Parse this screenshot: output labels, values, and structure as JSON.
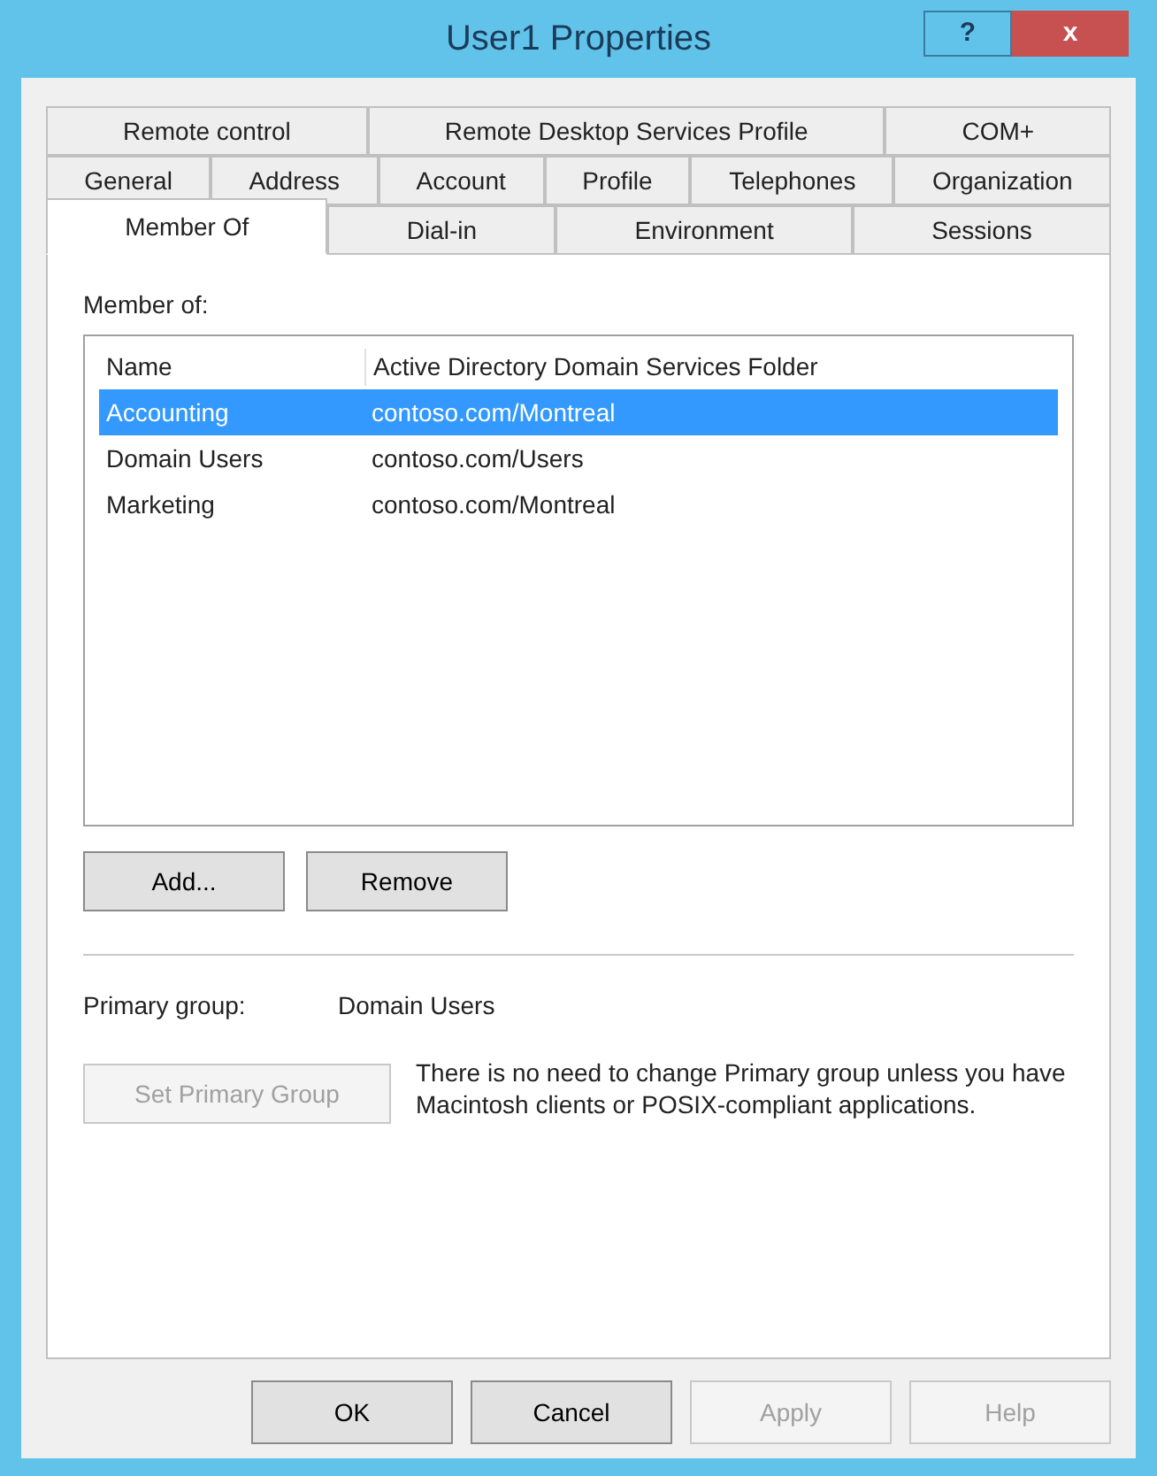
{
  "window": {
    "title": "User1 Properties",
    "controls": [
      "?",
      "x"
    ]
  },
  "tab_rows": [
    [
      {
        "label": "Remote control",
        "selected": false
      },
      {
        "label": "Remote Desktop Services Profile",
        "selected": false
      },
      {
        "label": "COM+",
        "selected": false
      }
    ],
    [
      {
        "label": "General",
        "selected": false
      },
      {
        "label": "Address",
        "selected": false
      },
      {
        "label": "Account",
        "selected": false
      },
      {
        "label": "Profile",
        "selected": false
      },
      {
        "label": "Telephones",
        "selected": false
      },
      {
        "label": "Organization",
        "selected": false
      }
    ],
    [
      {
        "label": "Member Of",
        "selected": true
      },
      {
        "label": "Dial-in",
        "selected": false
      },
      {
        "label": "Environment",
        "selected": false
      },
      {
        "label": "Sessions",
        "selected": false
      }
    ]
  ],
  "member_of": {
    "label": "Member of:",
    "columns": [
      "Name",
      "Active Directory Domain Services Folder"
    ],
    "rows": [
      {
        "name": "Accounting",
        "folder": "contoso.com/Montreal",
        "selected": true
      },
      {
        "name": "Domain Users",
        "folder": "contoso.com/Users",
        "selected": false
      },
      {
        "name": "Marketing",
        "folder": "contoso.com/Montreal",
        "selected": false
      }
    ]
  },
  "list_buttons": [
    {
      "label": "Add...",
      "disabled": false
    },
    {
      "label": "Remove",
      "disabled": false
    }
  ],
  "primary_group": {
    "label": "Primary group:",
    "value": "Domain Users"
  },
  "set_primary_button": {
    "label": "Set Primary Group",
    "disabled": true
  },
  "note": "There is no need to change Primary group unless you have Macintosh clients or POSIX-compliant applications.",
  "dialog_buttons": [
    {
      "label": "OK",
      "disabled": false
    },
    {
      "label": "Cancel",
      "disabled": false
    },
    {
      "label": "Apply",
      "disabled": true
    },
    {
      "label": "Help",
      "disabled": true
    }
  ]
}
